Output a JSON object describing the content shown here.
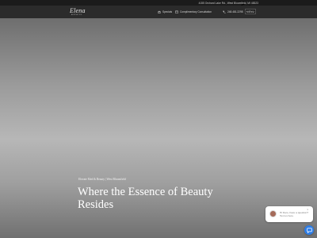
{
  "topbar": {
    "address": "4155 Orchard Lake Rd., West Bloomfield, MI 48323",
    "social": [
      {
        "icon": "facebook-icon",
        "glyph": "f"
      },
      {
        "icon": "instagram-icon",
        "glyph": "◎"
      }
    ]
  },
  "header": {
    "logo_text": "Elena",
    "logo_subtext": "AESTHETICS",
    "nav": {
      "specials": "Specials",
      "consultation": "Complimentary Consultation",
      "phone": "248.481.2298"
    },
    "menu_label": "MENU"
  },
  "hero": {
    "kicker": "Elevate Med & Beauty | West Bloomfield",
    "title": "Where the Essence of Beauty Resides"
  },
  "chat": {
    "message": "Hi there, have a question? Text us here.",
    "close_glyph": "×"
  },
  "colors": {
    "topbar_bg": "#1b1b1b",
    "navbar_bg": "#2b2b2b",
    "chat_accent": "#2f7ee6"
  }
}
